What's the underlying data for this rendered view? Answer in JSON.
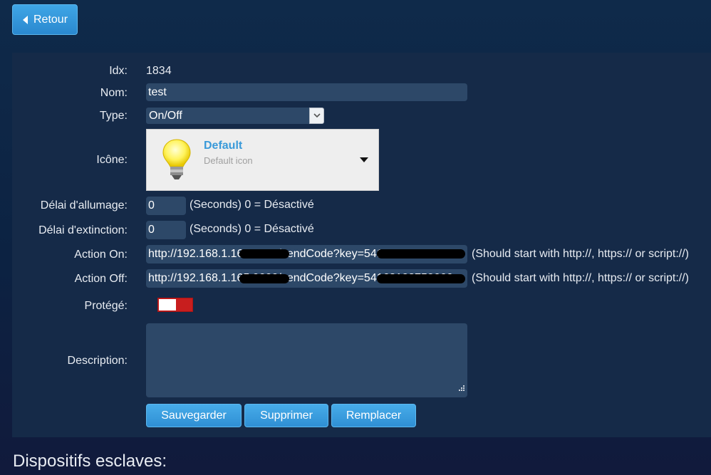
{
  "back_label": "Retour",
  "fields": {
    "idx_label": "Idx:",
    "idx_value": "1834",
    "name_label": "Nom:",
    "name_value": "test",
    "type_label": "Type:",
    "type_value": "On/Off",
    "icon_label": "Icône:",
    "icon_title": "Default",
    "icon_subtitle": "Default icon",
    "on_delay_label": "Délai d'allumage:",
    "on_delay_value": "0",
    "on_delay_hint": "(Seconds) 0 = Désactivé",
    "off_delay_label": "Délai d'extinction:",
    "off_delay_value": "0",
    "off_delay_hint": "(Seconds) 0 = Désactivé",
    "action_on_label": "Action On:",
    "action_on_value": "http://192.168.1.166:9000/sendCode?key=54168108752666",
    "action_on_hint": "(Should start with http://, https:// or script://)",
    "action_off_label": "Action Off:",
    "action_off_value": "http://192.168.1.165:9000/sendCode?key=54168108752666",
    "action_off_hint": "(Should start with http://, https:// or script://)",
    "protected_label": "Protégé:",
    "description_label": "Description:",
    "description_value": ""
  },
  "buttons": {
    "save": "Sauvegarder",
    "delete": "Supprimer",
    "replace": "Remplacer"
  },
  "slaves_title": "Dispositifs esclaves:",
  "colors": {
    "accent": "#2f8fd4",
    "toggle_off": "#c81e1e",
    "input_bg": "#2d4868",
    "panel_bg": "#152a48"
  },
  "icons": {
    "back": "chevron-left-icon",
    "select": "chevron-down-icon",
    "device": "light-bulb-icon",
    "dropdown": "caret-down-icon",
    "resize": "resize-grip-icon"
  }
}
